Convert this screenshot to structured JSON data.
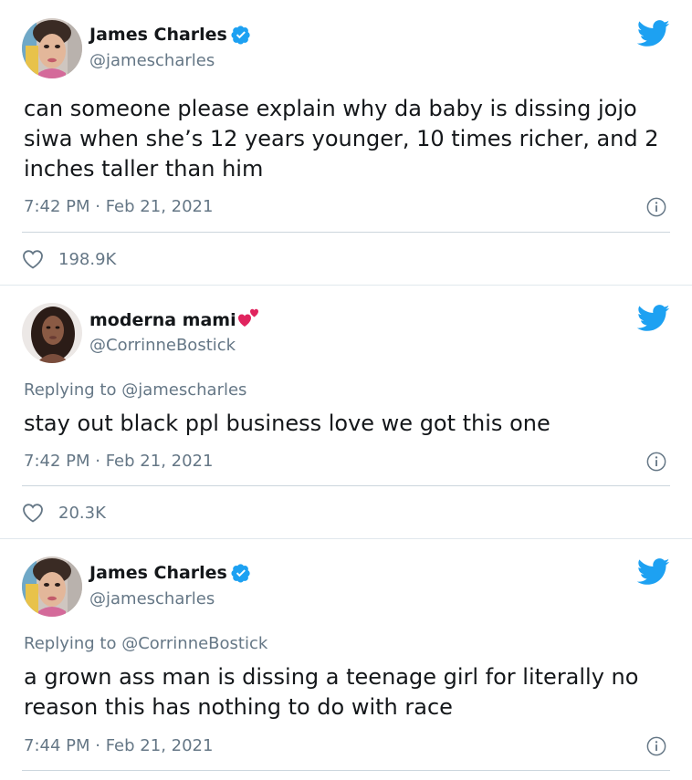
{
  "colors": {
    "accent": "#1da1f2",
    "muted": "#657786",
    "text": "#14171a",
    "verified": "#1da1f2",
    "heart_emoji": "#e0245e"
  },
  "tweets": [
    {
      "name": "James Charles",
      "handle": "@jamescharles",
      "verified": true,
      "text": "can someone please explain why da baby is dissing jojo siwa when she’s 12 years younger, 10 times richer, and 2 inches taller than him",
      "time": "7:42 PM · Feb 21, 2021",
      "likes": "198.9K",
      "icons": [
        "twitter-bird-icon",
        "verified-badge-icon",
        "info-icon",
        "heart-icon"
      ]
    },
    {
      "name": "moderna mami",
      "handle": "@CorrinneBostick",
      "replying_label": "Replying to",
      "replying_to": "@jamescharles",
      "text": "stay out black ppl business love we got this one",
      "time": "7:42 PM · Feb 21, 2021",
      "likes": "20.3K",
      "icons": [
        "twitter-bird-icon",
        "two-hearts-emoji-icon",
        "info-icon",
        "heart-icon"
      ]
    },
    {
      "name": "James Charles",
      "handle": "@jamescharles",
      "verified": true,
      "replying_label": "Replying to",
      "replying_to": "@CorrinneBostick",
      "text": "a grown ass man is dissing a teenage girl for literally no reason this has nothing to do with race",
      "time": "7:44 PM · Feb 21, 2021",
      "icons": [
        "twitter-bird-icon",
        "verified-badge-icon",
        "info-icon"
      ]
    }
  ]
}
